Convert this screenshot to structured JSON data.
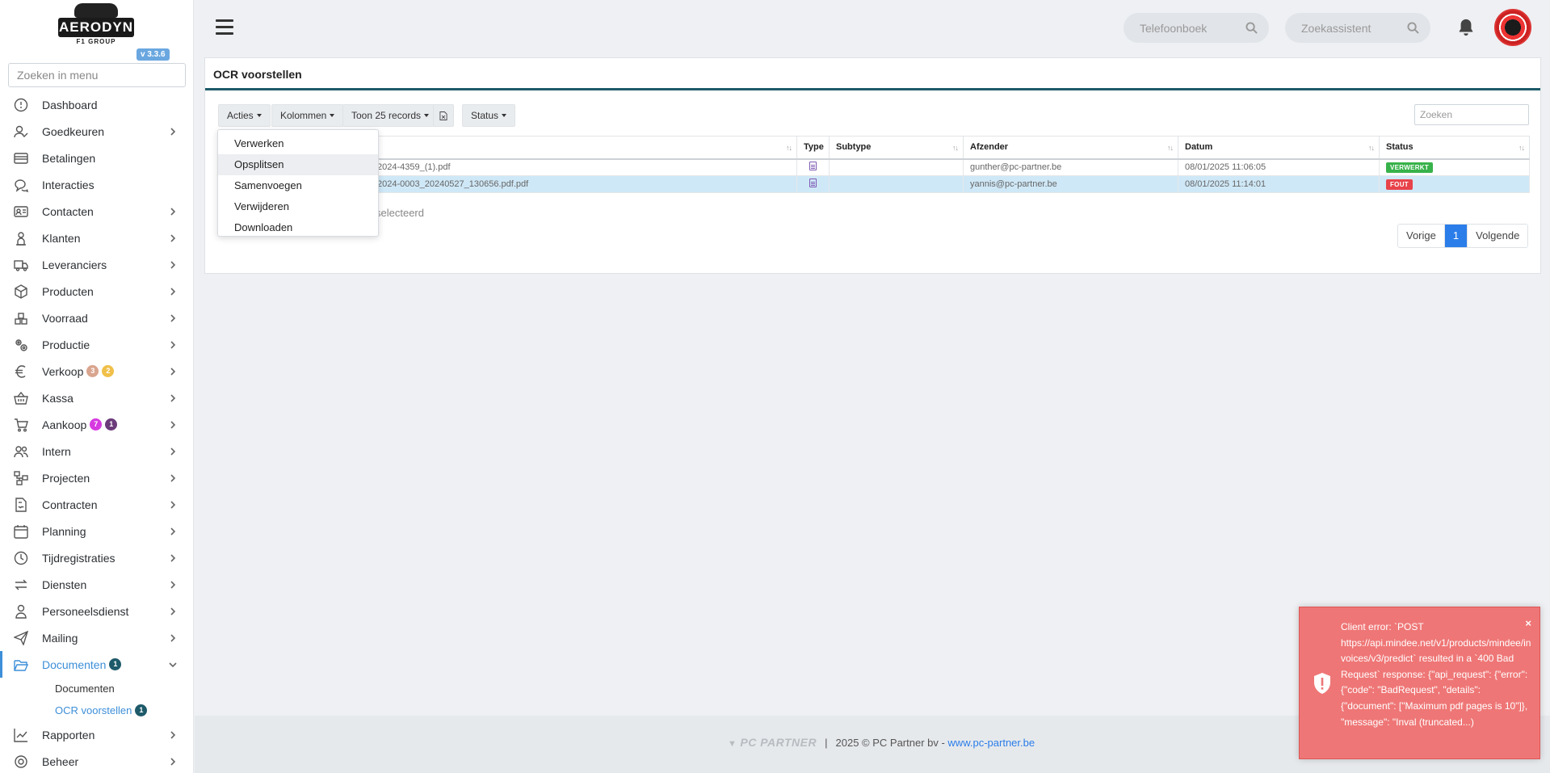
{
  "app": {
    "logo_text": "AERODYN",
    "logo_subtext": "F1 GROUP",
    "version": "v 3.3.6"
  },
  "sidebar": {
    "search_placeholder": "Zoeken in menu",
    "items": [
      {
        "label": "Dashboard",
        "icon": "dashboard-icon",
        "chevron": false
      },
      {
        "label": "Goedkeuren",
        "icon": "user-check-icon",
        "chevron": true
      },
      {
        "label": "Betalingen",
        "icon": "credit-card-icon",
        "chevron": false
      },
      {
        "label": "Interacties",
        "icon": "chat-icon",
        "chevron": false
      },
      {
        "label": "Contacten",
        "icon": "contact-card-icon",
        "chevron": true
      },
      {
        "label": "Klanten",
        "icon": "customer-icon",
        "chevron": true
      },
      {
        "label": "Leveranciers",
        "icon": "truck-icon",
        "chevron": true
      },
      {
        "label": "Producten",
        "icon": "box-icon",
        "chevron": true
      },
      {
        "label": "Voorraad",
        "icon": "boxes-icon",
        "chevron": true
      },
      {
        "label": "Productie",
        "icon": "gears-icon",
        "chevron": true
      },
      {
        "label": "Verkoop",
        "icon": "euro-icon",
        "chevron": true,
        "badges": [
          {
            "text": "3",
            "color": "#d9a58f"
          },
          {
            "text": "2",
            "color": "#f0c04a"
          }
        ]
      },
      {
        "label": "Kassa",
        "icon": "basket-icon",
        "chevron": true
      },
      {
        "label": "Aankoop",
        "icon": "cart-icon",
        "chevron": true,
        "badges": [
          {
            "text": "7",
            "color": "#d63ae0"
          },
          {
            "text": "1",
            "color": "#6b3b7a"
          }
        ]
      },
      {
        "label": "Intern",
        "icon": "users-icon",
        "chevron": true
      },
      {
        "label": "Projecten",
        "icon": "project-icon",
        "chevron": true
      },
      {
        "label": "Contracten",
        "icon": "contract-icon",
        "chevron": true
      },
      {
        "label": "Planning",
        "icon": "calendar-icon",
        "chevron": true
      },
      {
        "label": "Tijdregistraties",
        "icon": "timer-icon",
        "chevron": true
      },
      {
        "label": "Diensten",
        "icon": "exchange-icon",
        "chevron": true
      },
      {
        "label": "Personeelsdienst",
        "icon": "personnel-icon",
        "chevron": true
      },
      {
        "label": "Mailing",
        "icon": "paper-plane-icon",
        "chevron": true
      },
      {
        "label": "Documenten",
        "icon": "folder-open-icon",
        "chevron": true,
        "expanded": true,
        "active": true,
        "badges": [
          {
            "text": "1",
            "color": "#1e5a6a"
          }
        ]
      }
    ],
    "sub_items": [
      {
        "label": "Documenten",
        "active": false
      },
      {
        "label": "OCR voorstellen",
        "active": true,
        "badge": "1"
      }
    ],
    "after_items": [
      {
        "label": "Rapporten",
        "icon": "chart-line-icon",
        "chevron": true
      },
      {
        "label": "Beheer",
        "icon": "settings-icon",
        "chevron": true
      }
    ]
  },
  "topbar": {
    "phonebook_placeholder": "Telefoonboek",
    "assistant_placeholder": "Zoekassistent"
  },
  "card": {
    "title": "OCR voorstellen",
    "buttons": {
      "acties": "Acties",
      "kolommen": "Kolommen",
      "toon": "Toon 25 records",
      "status": "Status"
    },
    "search_placeholder": "Zoeken",
    "columns": [
      "",
      "Type",
      "Subtype",
      "Afzender",
      "Datum",
      "Status"
    ],
    "rows": [
      {
        "file": "2024-4359_(1).pdf",
        "subtype": "",
        "sender": "gunther@pc-partner.be",
        "date": "08/01/2025 11:06:05",
        "status": "VERWERKT",
        "status_color": "#38b24a",
        "selected": false
      },
      {
        "file": "2024-0003_20240527_130656.pdf.pdf",
        "subtype": "",
        "sender": "yannis@pc-partner.be",
        "date": "08/01/2025 11:14:01",
        "status": "FOUT",
        "status_color": "#e8434a",
        "selected": true
      }
    ],
    "selected_info": "selecteerd",
    "pagination": {
      "prev": "Vorige",
      "current": "1",
      "next": "Volgende"
    }
  },
  "dropdown": {
    "items": [
      "Verwerken",
      "Opsplitsen",
      "Samenvoegen",
      "Verwijderen",
      "Downloaden"
    ],
    "hovered_index": 1
  },
  "footer": {
    "logo": "PC PARTNER",
    "separator": "|",
    "copyright": "2025 © PC Partner bv - ",
    "link": "www.pc-partner.be"
  },
  "toast": {
    "close": "×",
    "message": "Client error: `POST https://api.mindee.net/v1/products/mindee/invoices/v3/predict` resulted in a `400 Bad Request` response: {\"api_request\": {\"error\": {\"code\": \"BadRequest\", \"details\": {\"document\": [\"Maximum pdf pages is 10\"]}, \"message\": \"Inval (truncated...)"
  },
  "colors": {
    "accent": "#3d8fd8",
    "header_rule": "#1e5a6a",
    "toast_bg": "#ef7676",
    "selected_row": "#cfe8f7",
    "page_active": "#2b7de9"
  }
}
